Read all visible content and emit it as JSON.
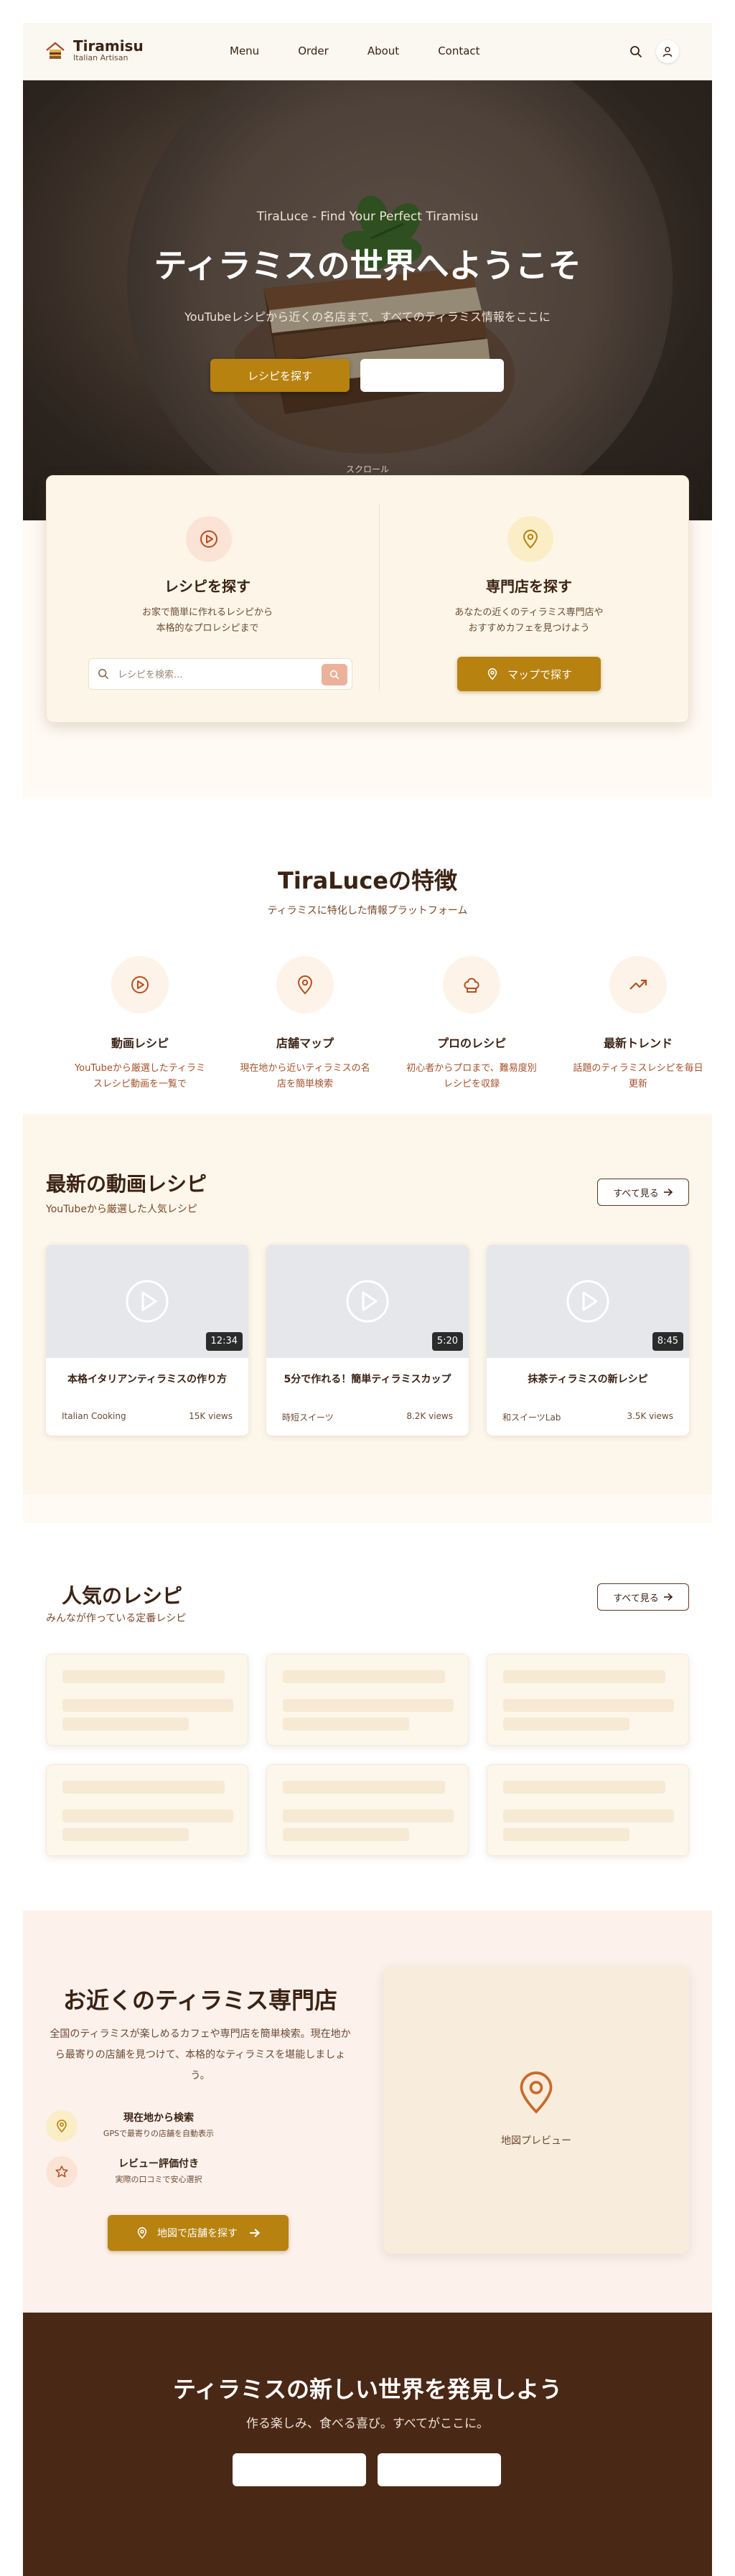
{
  "header": {
    "brand": "Tiramisu",
    "tagline": "Italian Artisan",
    "nav": [
      "Menu",
      "Order",
      "About",
      "Contact"
    ]
  },
  "hero": {
    "tag": "TiraLuce - Find Your Perfect Tiramisu",
    "title": "ティラミスの世界へようこそ",
    "subtitle": "YouTubeレシピから近くの名店まで、すべてのティラミス情報をここに",
    "primary_button": "レシピを探す",
    "scroll_label": "スクロール"
  },
  "quick": {
    "recipe": {
      "title": "レシピを探す",
      "description": "お家で簡単に作れるレシピから\n本格的なプロレシピまで",
      "search_placeholder": "レシピを検索..."
    },
    "shop": {
      "title": "専門店を探す",
      "description": "あなたの近くのティラミス専門店や\nおすすめカフェを見つけよう",
      "button": "マップで探す"
    }
  },
  "features": {
    "title": "TiraLuceの特徴",
    "subtitle": "ティラミスに特化した情報プラットフォーム",
    "items": [
      {
        "icon": "play-circle-icon",
        "name": "動画レシピ",
        "desc": "YouTubeから厳選したティラミスレシピ動画を一覧で"
      },
      {
        "icon": "map-pin-icon",
        "name": "店舗マップ",
        "desc": "現在地から近いティラミスの名店を簡単検索"
      },
      {
        "icon": "chef-hat-icon",
        "name": "プロのレシピ",
        "desc": "初心者からプロまで、難易度別レシピを収録"
      },
      {
        "icon": "trending-up-icon",
        "name": "最新トレンド",
        "desc": "話題のティラミスレシピを毎日更新"
      }
    ]
  },
  "videos": {
    "title": "最新の動画レシピ",
    "subtitle": "YouTubeから厳選した人気レシピ",
    "see_all": "すべて見る",
    "items": [
      {
        "duration": "12:34",
        "title": "本格イタリアンティラミスの作り方",
        "channel": "Italian Cooking",
        "views": "15K views"
      },
      {
        "duration": "5:20",
        "title": "5分で作れる！簡単ティラミスカップ",
        "channel": "時短スイーツ",
        "views": "8.2K views"
      },
      {
        "duration": "8:45",
        "title": "抹茶ティラミスの新レシピ",
        "channel": "和スイーツLab",
        "views": "3.5K views"
      }
    ]
  },
  "popular": {
    "title": "人気のレシピ",
    "subtitle": "みんなが作っている定番レシピ",
    "see_all": "すべて見る"
  },
  "shops": {
    "title": "お近くのティラミス専門店",
    "description": "全国のティラミスが楽しめるカフェや専門店を簡単検索。現在地から最寄りの店舗を見つけて、本格的なティラミスを堪能しましょう。",
    "features": [
      {
        "icon": "map-pin-icon",
        "title": "現在地から検索",
        "desc": "GPSで最寄りの店舗を自動表示"
      },
      {
        "icon": "star-icon",
        "title": "レビュー評価付き",
        "desc": "実際の口コミで安心選択"
      }
    ],
    "button": "地図で店舗を探す",
    "map_label": "地図プレビュー"
  },
  "cta": {
    "title": "ティラミスの新しい世界を発見しよう",
    "subtitle": "作る楽しみ、食べる喜び。すべてがここに。"
  },
  "colors": {
    "accent": "#b7820f",
    "brown_dark": "#3b2314",
    "cta_bg": "#4a2816",
    "icon_rust": "#b5501f"
  }
}
